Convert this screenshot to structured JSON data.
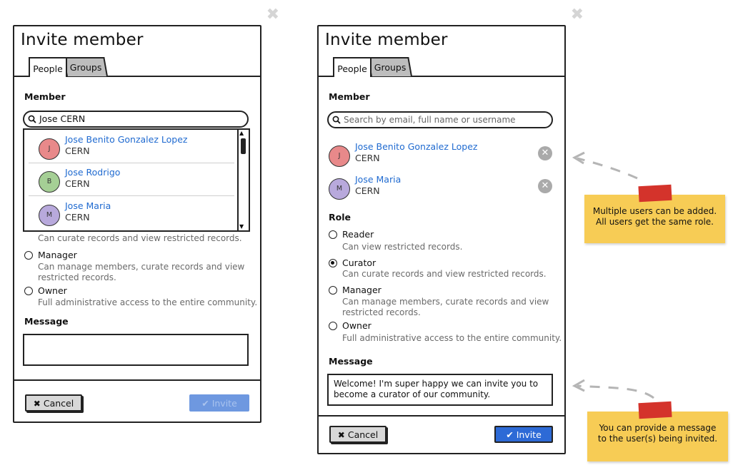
{
  "left_dialog": {
    "title": "Invite member",
    "tabs": [
      {
        "label": "People"
      },
      {
        "label": "Groups"
      }
    ],
    "member_label": "Member",
    "search_value": "Jose CERN",
    "results": [
      {
        "initial": "J",
        "name": "Jose Benito Gonzalez Lopez",
        "org": "CERN",
        "avatar_color": "#e8898a"
      },
      {
        "initial": "B",
        "name": "Jose Rodrigo",
        "org": "CERN",
        "avatar_color": "#a5cf95"
      },
      {
        "initial": "M",
        "name": "Jose Maria",
        "org": "CERN",
        "avatar_color": "#b8a9dc"
      }
    ],
    "roles": [
      {
        "name": "",
        "desc": "Can curate records and view restricted records."
      },
      {
        "name": "Manager",
        "desc": "Can manage members, curate records and view restricted records."
      },
      {
        "name": "Owner",
        "desc": "Full administrative access to the entire community."
      }
    ],
    "message_label": "Message",
    "message_value": "",
    "cancel_label": "Cancel",
    "invite_label": "Invite"
  },
  "right_dialog": {
    "title": "Invite member",
    "tabs": [
      {
        "label": "People"
      },
      {
        "label": "Groups"
      }
    ],
    "member_label": "Member",
    "search_placeholder": "Search by email, full name or username",
    "selected": [
      {
        "initial": "J",
        "name": "Jose Benito Gonzalez Lopez",
        "org": "CERN",
        "avatar_color": "#e8898a"
      },
      {
        "initial": "M",
        "name": "Jose Maria",
        "org": "CERN",
        "avatar_color": "#b8a9dc"
      }
    ],
    "role_label": "Role",
    "roles": [
      {
        "name": "Reader",
        "desc": "Can view restricted records.",
        "checked": false
      },
      {
        "name": "Curator",
        "desc": "Can curate records and view restricted records.",
        "checked": true
      },
      {
        "name": "Manager",
        "desc": "Can manage members, curate records and view restricted records.",
        "checked": false
      },
      {
        "name": "Owner",
        "desc": "Full administrative access to the entire community.",
        "checked": false
      }
    ],
    "message_label": "Message",
    "message_value": "Welcome! I'm super happy we can invite you to become a curator of our community.",
    "cancel_label": "Cancel",
    "invite_label": "Invite"
  },
  "notes": [
    {
      "text": "Multiple users can be added. All users get the same role."
    },
    {
      "text": "You can provide a message to the user(s) being invited."
    }
  ],
  "colors": {
    "link": "#1f6ad0",
    "primary_button": "#2d6ad6",
    "sticky_note": "#f7cc55",
    "tape": "#d4332b"
  }
}
